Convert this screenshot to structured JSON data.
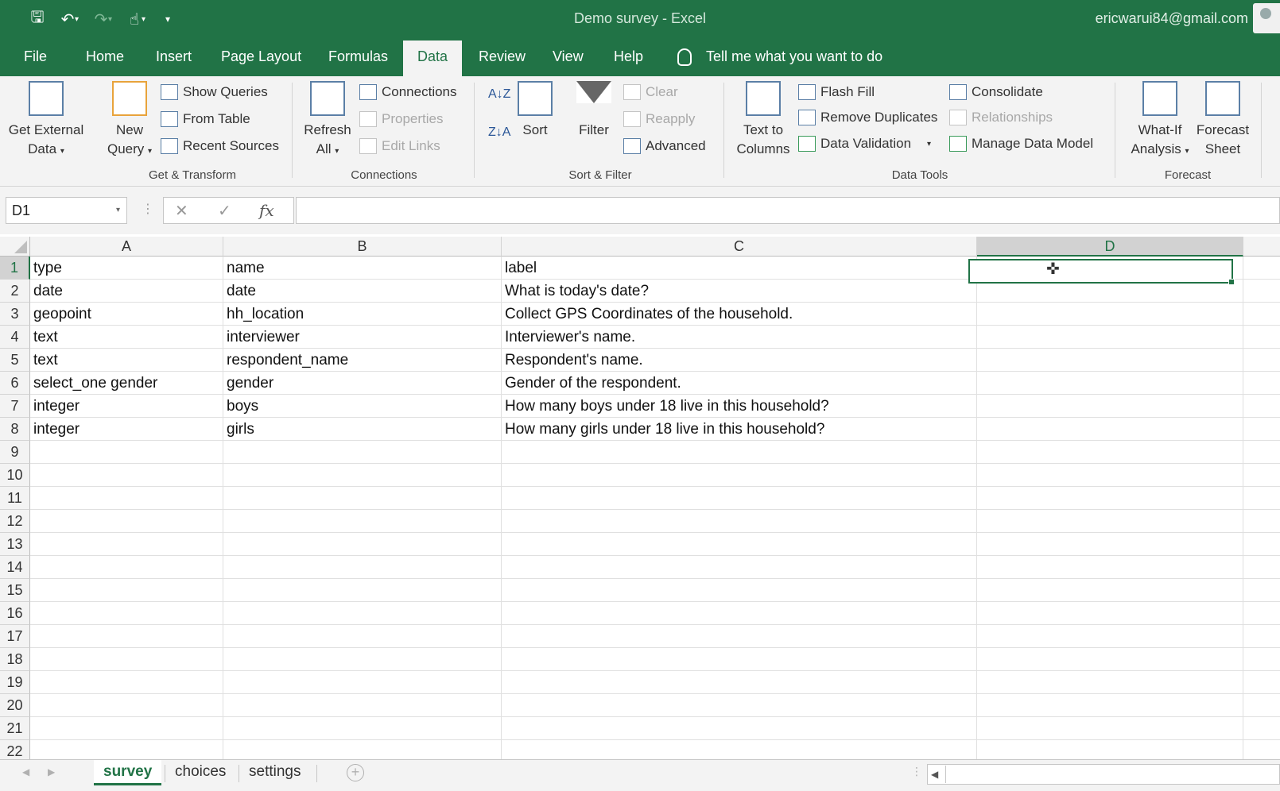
{
  "titlebar": {
    "title": "Demo survey  -  Excel",
    "account": "ericwarui84@gmail.com"
  },
  "menu": {
    "tabs": [
      "File",
      "Home",
      "Insert",
      "Page Layout",
      "Formulas",
      "Data",
      "Review",
      "View",
      "Help"
    ],
    "active_tab": "Data",
    "tell_me": "Tell me what you want to do"
  },
  "ribbon": {
    "get_external": {
      "line1": "Get External",
      "line2": "Data"
    },
    "new_query": {
      "line1": "New",
      "line2": "Query"
    },
    "show_queries": "Show Queries",
    "from_table": "From Table",
    "recent_sources": "Recent Sources",
    "group_get_transform": "Get & Transform",
    "refresh": {
      "line1": "Refresh",
      "line2": "All"
    },
    "connections": "Connections",
    "properties": "Properties",
    "edit_links": "Edit Links",
    "group_connections": "Connections",
    "sort": "Sort",
    "filter": "Filter",
    "clear": "Clear",
    "reapply": "Reapply",
    "advanced": "Advanced",
    "group_sort_filter": "Sort & Filter",
    "text_to_columns": {
      "line1": "Text to",
      "line2": "Columns"
    },
    "flash_fill": "Flash Fill",
    "remove_duplicates": "Remove Duplicates",
    "data_validation": "Data Validation",
    "consolidate": "Consolidate",
    "relationships": "Relationships",
    "manage_data_model": "Manage Data Model",
    "group_data_tools": "Data Tools",
    "what_if": {
      "line1": "What-If",
      "line2": "Analysis"
    },
    "forecast_sheet": {
      "line1": "Forecast",
      "line2": "Sheet"
    },
    "group_forecast": "Forecast"
  },
  "formula_bar": {
    "name_box": "D1",
    "fx": "fx",
    "value": ""
  },
  "grid": {
    "columns": [
      "A",
      "B",
      "C",
      "D"
    ],
    "selected_column": "D",
    "selected_row": "1",
    "row_numbers": [
      "1",
      "2",
      "3",
      "4",
      "5",
      "6",
      "7",
      "8",
      "9",
      "10",
      "11",
      "12",
      "13",
      "14",
      "15",
      "16",
      "17",
      "18",
      "19",
      "20",
      "21",
      "22"
    ],
    "rows": [
      [
        "type",
        "name",
        "label"
      ],
      [
        "date",
        "date",
        "What is today's date?"
      ],
      [
        "geopoint",
        "hh_location",
        "Collect GPS Coordinates of the household."
      ],
      [
        "text",
        "interviewer",
        "Interviewer's name."
      ],
      [
        "text",
        "respondent_name",
        "Respondent's name."
      ],
      [
        "select_one gender",
        "gender",
        "Gender of the respondent."
      ],
      [
        "integer",
        "boys",
        "How many boys under 18 live in this household?"
      ],
      [
        "integer",
        "girls",
        "How many girls under 18 live in this household?"
      ]
    ]
  },
  "sheets": {
    "tabs": [
      "survey",
      "choices",
      "settings"
    ],
    "active": "survey"
  }
}
